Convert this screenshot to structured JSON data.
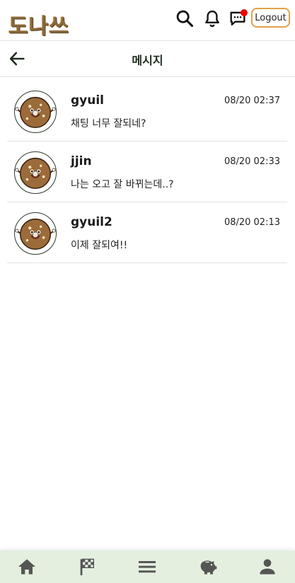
{
  "app": {
    "logo_text": "도나쓰",
    "logout_label": "Logout",
    "has_unread_chat": true
  },
  "header": {
    "title": "메시지"
  },
  "conversations": [
    {
      "name": "gyuil",
      "time": "08/20 02:37",
      "message": "채팅 너무 잘되네?",
      "avatar": "donut-mascot-icon"
    },
    {
      "name": "jjin",
      "time": "08/20 02:33",
      "message": "나는 오고 잘 바뀌는데..?",
      "avatar": "donut-mascot-icon"
    },
    {
      "name": "gyuil2",
      "time": "08/20 02:13",
      "message": "이제 잘되여!!",
      "avatar": "donut-mascot-icon"
    }
  ],
  "bottom_nav": [
    {
      "icon": "home-icon"
    },
    {
      "icon": "checkered-flag-icon"
    },
    {
      "icon": "menu-icon"
    },
    {
      "icon": "piggy-bank-icon"
    },
    {
      "icon": "person-icon"
    }
  ],
  "colors": {
    "nav_bg": "#e4efe0",
    "logout_border": "#e0a24a",
    "notify_dot": "#f00000",
    "logo": "#8b6a3c"
  }
}
